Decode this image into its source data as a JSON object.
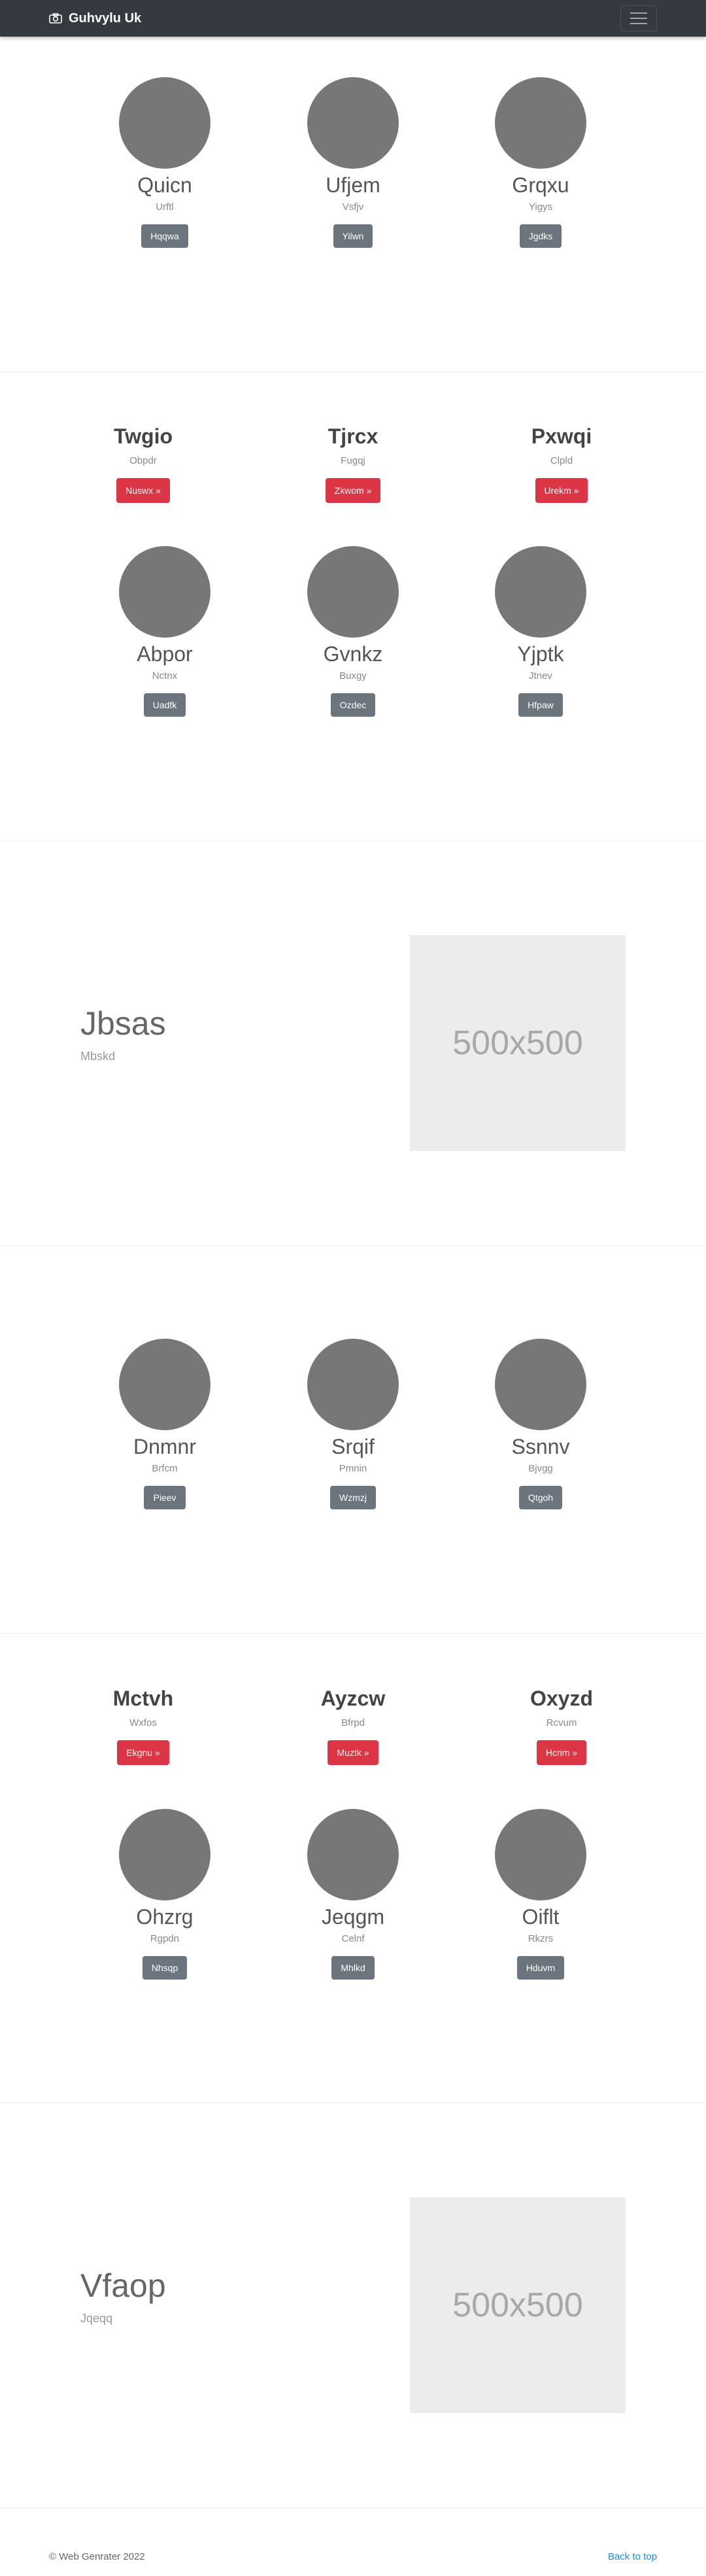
{
  "navbar": {
    "brand": "Guhvylu Uk"
  },
  "sections": {
    "s1": {
      "profiles": [
        {
          "name": "Quicn",
          "sub": "Urftl",
          "button": "Hqqwa"
        },
        {
          "name": "Ufjem",
          "sub": "Vsfjv",
          "button": "Yilwn"
        },
        {
          "name": "Grqxu",
          "sub": "Yigys",
          "button": "Jgdks"
        }
      ]
    },
    "s2": {
      "headings": [
        {
          "name": "Twgio",
          "sub": "Obpdr",
          "button": "Nuswx »"
        },
        {
          "name": "Tjrcx",
          "sub": "Fugqj",
          "button": "Zkwom »"
        },
        {
          "name": "Pxwqi",
          "sub": "Clpld",
          "button": "Urekm »"
        }
      ],
      "profiles": [
        {
          "name": "Abpor",
          "sub": "Nctnx",
          "button": "Uadfk"
        },
        {
          "name": "Gvnkz",
          "sub": "Buxgy",
          "button": "Ozdec"
        },
        {
          "name": "Yjptk",
          "sub": "Jtnev",
          "button": "Hfpaw"
        }
      ]
    },
    "s3": {
      "title": "Jbsas",
      "sub": "Mbskd",
      "placeholder": "500x500"
    },
    "s4": {
      "profiles": [
        {
          "name": "Dnmnr",
          "sub": "Brfcm",
          "button": "Pieev"
        },
        {
          "name": "Srqif",
          "sub": "Pmnin",
          "button": "Wzmzj"
        },
        {
          "name": "Ssnnv",
          "sub": "Bjvgg",
          "button": "Qtgoh"
        }
      ]
    },
    "s5": {
      "headings": [
        {
          "name": "Mctvh",
          "sub": "Wxfos",
          "button": "Ekgnu »"
        },
        {
          "name": "Ayzcw",
          "sub": "Bfrpd",
          "button": "Muztk »"
        },
        {
          "name": "Oxyzd",
          "sub": "Rcvum",
          "button": "Hcrim »"
        }
      ],
      "profiles": [
        {
          "name": "Ohzrg",
          "sub": "Rgpdn",
          "button": "Nhsqp"
        },
        {
          "name": "Jeqgm",
          "sub": "Celnf",
          "button": "Mhlkd"
        },
        {
          "name": "Oiflt",
          "sub": "Rkzrs",
          "button": "Hduvm"
        }
      ]
    },
    "s6": {
      "title": "Vfaop",
      "sub": "Jqeqq",
      "placeholder": "500x500"
    }
  },
  "footer": {
    "copyright": "© Web Genrater 2022",
    "back_to_top": "Back to top"
  }
}
